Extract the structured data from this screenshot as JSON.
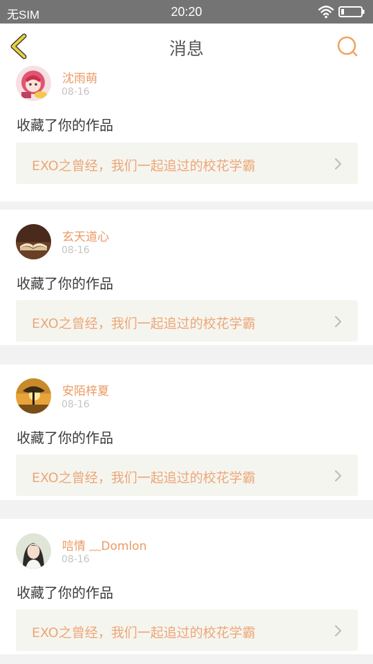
{
  "status_bar": {
    "carrier": "无SIM",
    "time": "20:20"
  },
  "header": {
    "title": "消息"
  },
  "colors": {
    "accent": "#eb9a64",
    "back_icon": "#ead23a",
    "card_link_bg": "#f5f5ef"
  },
  "messages": [
    {
      "user": "沈雨萌",
      "date": "08-16",
      "action": "收藏了你的作品",
      "work_title": "EXO之曾经，我们一起追过的校花学霸",
      "avatar_icon": "anime-girl-avatar"
    },
    {
      "user": "玄天道心",
      "date": "08-16",
      "action": "收藏了你的作品",
      "work_title": "EXO之曾经，我们一起追过的校花学霸",
      "avatar_icon": "open-book-avatar"
    },
    {
      "user": "安陌梓夏",
      "date": "08-16",
      "action": "收藏了你的作品",
      "work_title": "EXO之曾经，我们一起追过的校花学霸",
      "avatar_icon": "sunset-tree-avatar"
    },
    {
      "user": "唁情 ﹏Domlon",
      "date": "08-16",
      "action": "收藏了你的作品",
      "work_title": "EXO之曾经，我们一起追过的校花学霸",
      "avatar_icon": "girl-portrait-avatar"
    }
  ]
}
